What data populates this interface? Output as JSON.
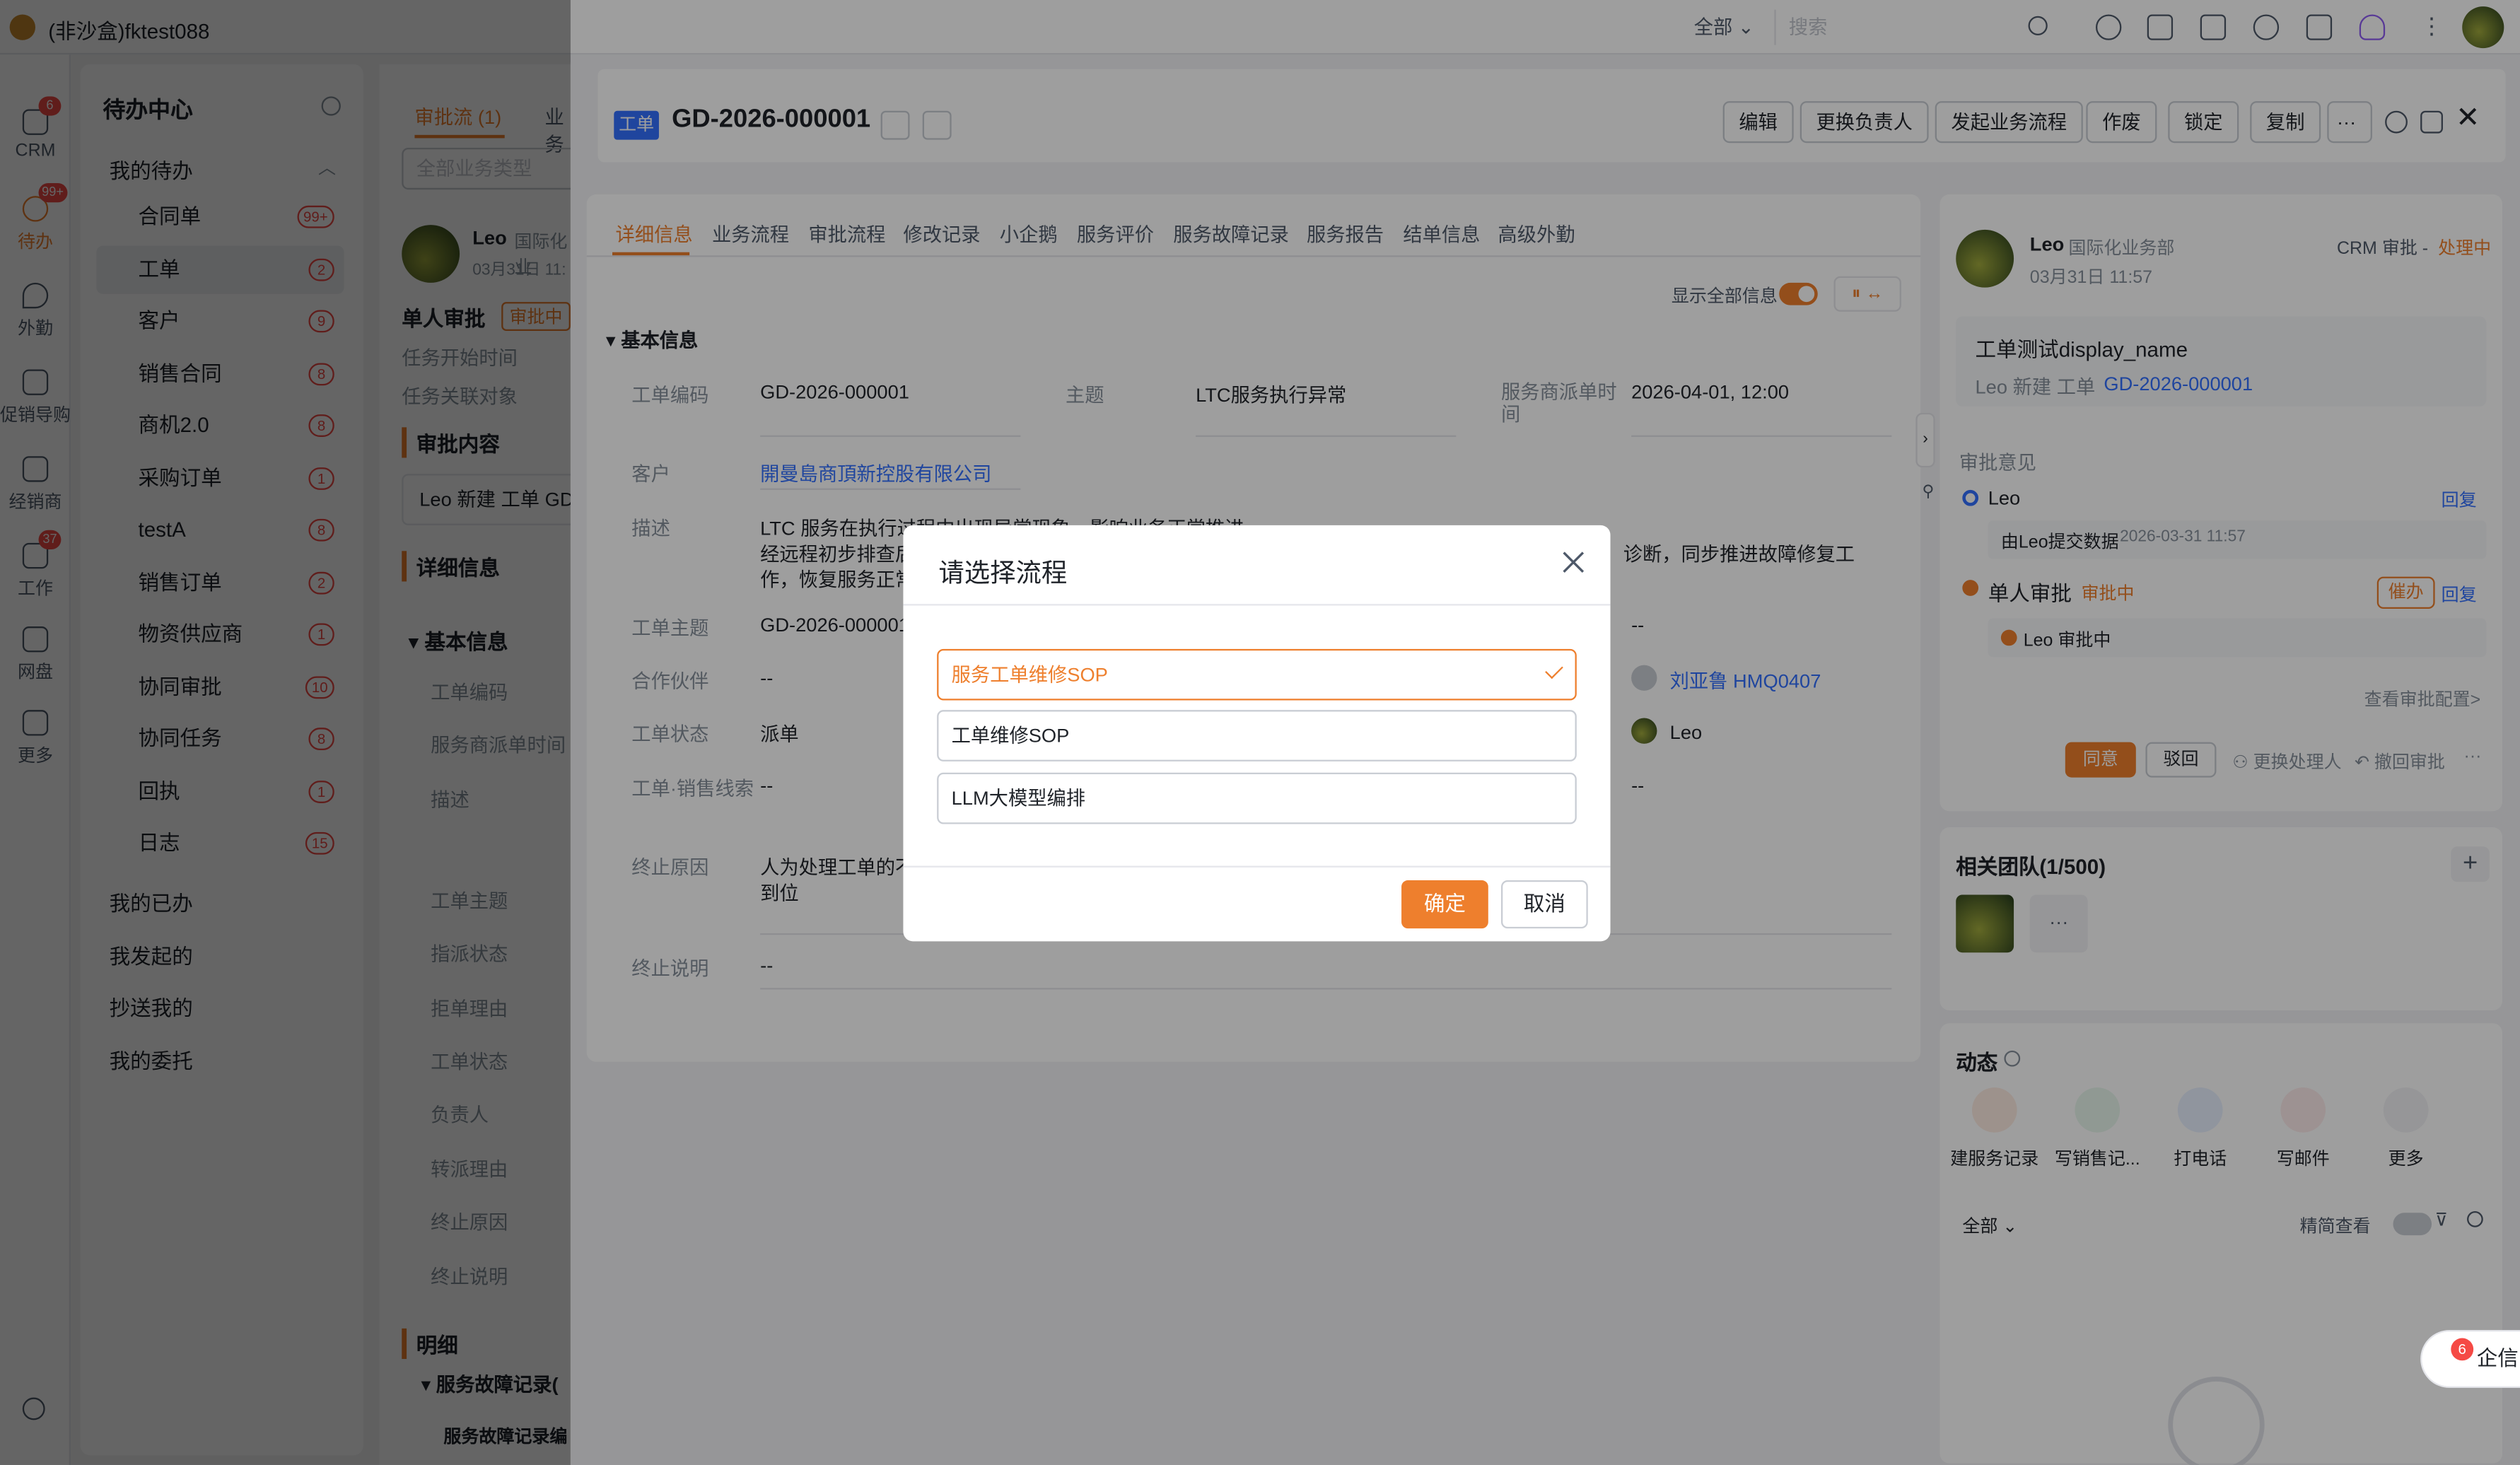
{
  "topbar": {
    "title": "(非沙盒)fktest088",
    "scope": "全部",
    "search_placeholder": "搜索"
  },
  "leftnav": {
    "items": [
      {
        "label": "CRM",
        "badge": "6"
      },
      {
        "label": "待办",
        "badge": "99+"
      },
      {
        "label": "外勤",
        "badge": ""
      },
      {
        "label": "促销导购",
        "badge": ""
      },
      {
        "label": "经销商",
        "badge": ""
      },
      {
        "label": "工作",
        "badge": "37"
      },
      {
        "label": "网盘",
        "badge": ""
      },
      {
        "label": "更多",
        "badge": ""
      }
    ]
  },
  "sidebar": {
    "title": "待办中心",
    "group_my_todo": "我的待办",
    "items": [
      {
        "label": "合同单",
        "count": "99+"
      },
      {
        "label": "工单",
        "count": "2"
      },
      {
        "label": "客户",
        "count": "9"
      },
      {
        "label": "销售合同",
        "count": "8"
      },
      {
        "label": "商机2.0",
        "count": "8"
      },
      {
        "label": "采购订单",
        "count": "1"
      },
      {
        "label": "testA",
        "count": "8"
      },
      {
        "label": "销售订单",
        "count": "2"
      },
      {
        "label": "物资供应商",
        "count": "1"
      },
      {
        "label": "协同审批",
        "count": "10"
      },
      {
        "label": "协同任务",
        "count": "8"
      },
      {
        "label": "回执",
        "count": "1"
      },
      {
        "label": "日志",
        "count": "15"
      }
    ],
    "groups": [
      "我的已办",
      "我发起的",
      "抄送我的",
      "我的委托"
    ]
  },
  "midpanel": {
    "tab_approval": "审批流 (1)",
    "tab_business": "业务",
    "filter_placeholder": "全部业务类型",
    "user": "Leo",
    "user_dept": "国际化业",
    "time": "03月31日 11:",
    "approval_title": "单人审批",
    "approval_status": "审批中",
    "field1": "任务开始时间",
    "field2": "任务关联对象",
    "section_content": "审批内容",
    "content_text": "Leo 新建 工单 GD",
    "section_detail": "详细信息",
    "section_basic": "基本信息",
    "fields": [
      "工单编码",
      "服务商派单时间",
      "描述",
      "工单主题",
      "指派状态",
      "拒单理由",
      "工单状态",
      "负责人",
      "转派理由",
      "终止原因",
      "终止说明"
    ],
    "section_detail2": "明细",
    "sub1": "服务故障记录(",
    "sub2": "服务故障记录编"
  },
  "drawer": {
    "header": {
      "tag": "工单",
      "code": "GD-2026-000001",
      "buttons": [
        "编辑",
        "更换负责人",
        "发起业务流程",
        "作废",
        "锁定",
        "复制"
      ],
      "more": "···"
    },
    "tabs": [
      "详细信息",
      "业务流程",
      "审批流程",
      "修改记录",
      "小企鹅",
      "服务评价",
      "服务故障记录",
      "服务报告",
      "结单信息",
      "高级外勤"
    ],
    "show_all_label": "显示全部信息",
    "section_basic": "基本信息",
    "fields": {
      "code_label": "工单编码",
      "code_value": "GD-2026-000001",
      "subject_label": "主题",
      "subject_value": "LTC服务执行异常",
      "dispatch_label": "服务商派单时间",
      "dispatch_value": "2026-04-01, 12:00",
      "customer_label": "客户",
      "customer_value": "開曼島商頂新控股有限公司",
      "desc_label": "描述",
      "desc_line1": "LTC 服务在执行过程中出现异常现象，影响业务正常推进",
      "desc_line2": "经远程初步排查后",
      "desc_line2_tail": "诊断，同步推进故障修复工",
      "desc_line3": "作，恢复服务正常",
      "title_label": "工单主题",
      "title_value": "GD-2026-000001",
      "partner_label": "合作伙伴",
      "partner_value": "--",
      "status_label": "工单状态",
      "status_value": "派单",
      "lead_label": "工单·销售线索",
      "lead_value": "--",
      "stop_reason_label": "终止原因",
      "stop_reason_line1": "人为处理工单的不",
      "stop_reason_line2": "到位",
      "stop_note_label": "终止说明",
      "stop_note_value": "--",
      "right_dash1": "--",
      "assignee_value": "刘亚鲁 HMQ0407",
      "owner_value": "Leo",
      "right_dash2": "--"
    }
  },
  "rightcol": {
    "user": "Leo",
    "dept": "国际化业务部",
    "time": "03月31日 11:57",
    "crm_label": "CRM 审批 -",
    "crm_status": "处理中",
    "card_title": "工单测试display_name",
    "card_sub_prefix": "Leo 新建 工单",
    "card_sub_link": "GD-2026-000001",
    "opinion_label": "审批意见",
    "step1_user": "Leo",
    "reply": "回复",
    "step1_note": "由Leo提交数据",
    "step1_time": "2026-03-31 11:57",
    "step2_title": "单人审批",
    "step2_status": "审批中",
    "urge": "催办",
    "step2_sub": "Leo  审批中",
    "view_config": "查看审批配置>",
    "agree": "同意",
    "reject": "驳回",
    "change_handler": "更换处理人",
    "withdraw": "撤回审批",
    "more_dots": "···",
    "team_title": "相关团队(1/500)",
    "team_more": "···",
    "dynamic_title": "动态",
    "actions": [
      "建服务记录",
      "写销售记...",
      "打电话",
      "写邮件",
      "更多"
    ],
    "filter": "全部",
    "simple_view": "精简查看"
  },
  "modal": {
    "title": "请选择流程",
    "options": [
      "服务工单维修SOP",
      "工单维修SOP",
      "LLM大模型编排"
    ],
    "selected": "服务工单维修SOP",
    "ok": "确定",
    "cancel": "取消"
  },
  "qixin": {
    "label": "企信",
    "badge": "6"
  },
  "colors": {
    "accent": "#ee7f2d",
    "link": "#3370ff",
    "danger": "#f54a45"
  }
}
